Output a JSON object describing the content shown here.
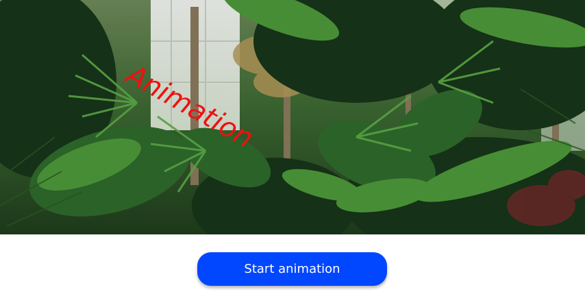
{
  "hero": {
    "image_icon": "jungle-plants-photo",
    "overlay_text": "Animation",
    "overlay_color": "#ee1111"
  },
  "controls": {
    "start_label": "Start animation",
    "start_color": "#0047ff"
  }
}
